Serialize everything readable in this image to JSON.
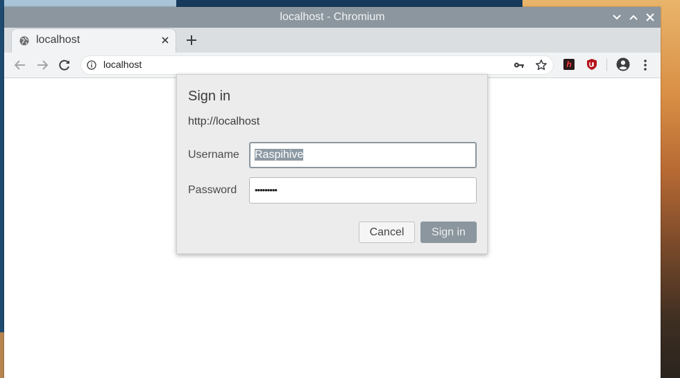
{
  "window": {
    "title": "localhost - Chromium"
  },
  "tab": {
    "title": "localhost"
  },
  "omnibox": {
    "url": "localhost"
  },
  "extensions": {
    "ext1_glyph": "h"
  },
  "dialog": {
    "title": "Sign in",
    "origin": "http://localhost",
    "username_label": "Username",
    "username_value": "Raspihive",
    "password_label": "Password",
    "password_value": "•••••••••",
    "cancel_label": "Cancel",
    "signin_label": "Sign in"
  },
  "colors": {
    "titlebar": "#8b969e",
    "accent": "#8b969e",
    "selection": "#8d9aa4"
  }
}
